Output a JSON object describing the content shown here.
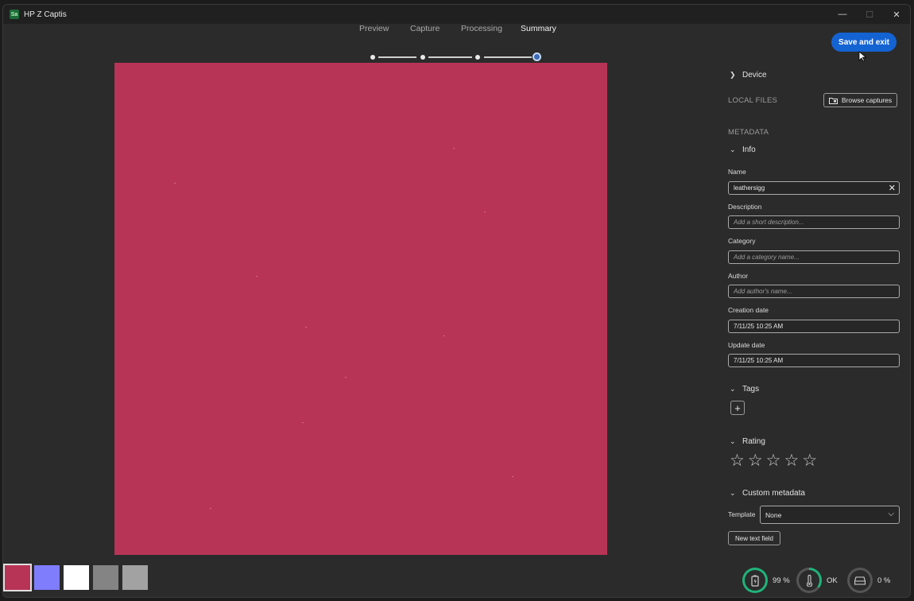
{
  "app": {
    "logo": "Sa",
    "title": "HP Z Captis",
    "controls": {
      "minimize": "—",
      "maximize": "☐",
      "close": "✕"
    }
  },
  "steps": [
    {
      "label": "Preview",
      "active": false
    },
    {
      "label": "Capture",
      "active": false
    },
    {
      "label": "Processing",
      "active": false
    },
    {
      "label": "Summary",
      "active": true
    }
  ],
  "save_button": "Save and exit",
  "preview": {
    "texture_color": "#b83456"
  },
  "swatches": [
    {
      "name": "base-color",
      "color": "#b83456",
      "selected": true
    },
    {
      "name": "normal",
      "color": "#7f7dfc",
      "selected": false
    },
    {
      "name": "white",
      "color": "#ffffff",
      "selected": false
    },
    {
      "name": "roughness",
      "color": "#848484",
      "selected": false
    },
    {
      "name": "gray",
      "color": "#a2a2a2",
      "selected": false
    }
  ],
  "panel": {
    "device": "Device",
    "local_files": "LOCAL FILES",
    "browse": "Browse captures",
    "metadata": "METADATA",
    "info": "Info",
    "fields": {
      "name_label": "Name",
      "name_value": "leathersigg",
      "description_label": "Description",
      "description_placeholder": "Add a short description...",
      "category_label": "Category",
      "category_placeholder": "Add a category name...",
      "author_label": "Author",
      "author_placeholder": "Add author's name...",
      "creation_label": "Creation date",
      "creation_value": "7/11/25 10:25 AM",
      "update_label": "Update date",
      "update_value": "7/11/25 10:25 AM"
    },
    "tags": "Tags",
    "rating": {
      "label": "Rating",
      "value": 0,
      "max": 5
    },
    "custom_metadata": "Custom metadata",
    "template_label": "Template",
    "template_value": "None",
    "new_text_field": "New text field"
  },
  "status": {
    "battery": "99 %",
    "temperature": "OK",
    "storage": "0 %",
    "accent": "#1fb37a"
  }
}
